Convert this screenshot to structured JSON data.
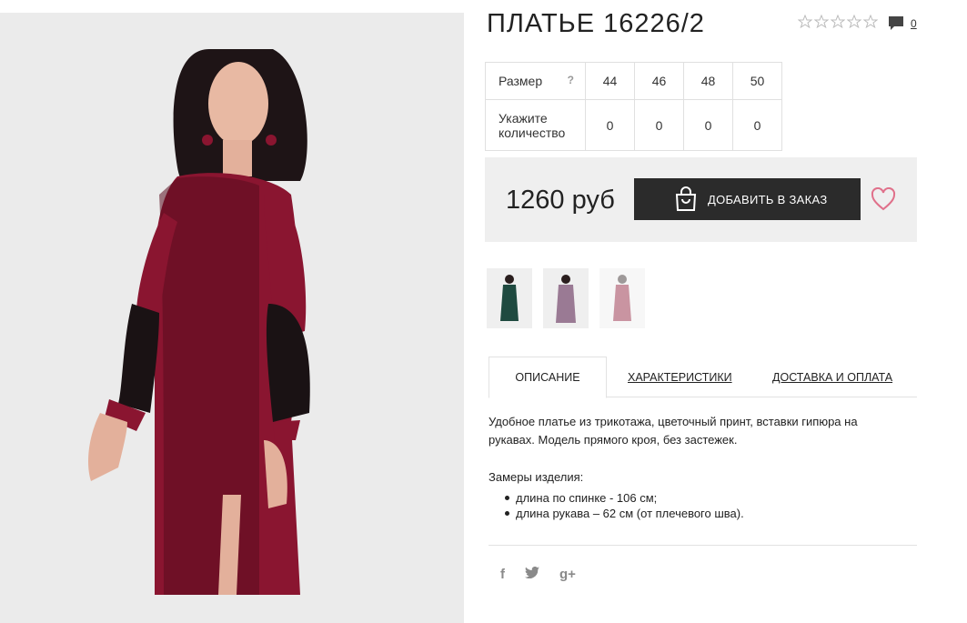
{
  "product": {
    "title": "ПЛАТЬЕ 16226/2",
    "comments_count": "0",
    "price": "1260 руб",
    "add_to_order": "ДОБАВИТЬ В ЗАКАЗ"
  },
  "size_table": {
    "size_label": "Размер",
    "help": "?",
    "sizes": [
      "44",
      "46",
      "48",
      "50"
    ],
    "qty_label_line1": "Укажите",
    "qty_label_line2": "количество",
    "quantities": [
      "0",
      "0",
      "0",
      "0"
    ]
  },
  "tabs": {
    "description": "ОПИСАНИЕ",
    "specs": "ХАРАКТЕРИСТИКИ",
    "delivery": "ДОСТАВКА И ОПЛАТА"
  },
  "description": {
    "text": "Удобное платье из трикотажа, цветочный принт, вставки гипюра на рукавах. Модель прямого кроя, без застежек.",
    "measurements_title": "Замеры изделия:",
    "measurements": [
      "длина по спинке - 106 см;",
      "длина рукава – 62 см (от плечевого шва)."
    ]
  },
  "social": {
    "facebook": "f",
    "twitter": "t",
    "google": "g+"
  },
  "colors": {
    "dress": "#8a1530",
    "button": "#2b2b2b",
    "heart": "#e0708a",
    "price_bg": "#efefef"
  },
  "icons": [
    "star-icon",
    "comment-icon",
    "bag-icon",
    "heart-icon",
    "facebook-icon",
    "twitter-icon",
    "google-plus-icon"
  ]
}
